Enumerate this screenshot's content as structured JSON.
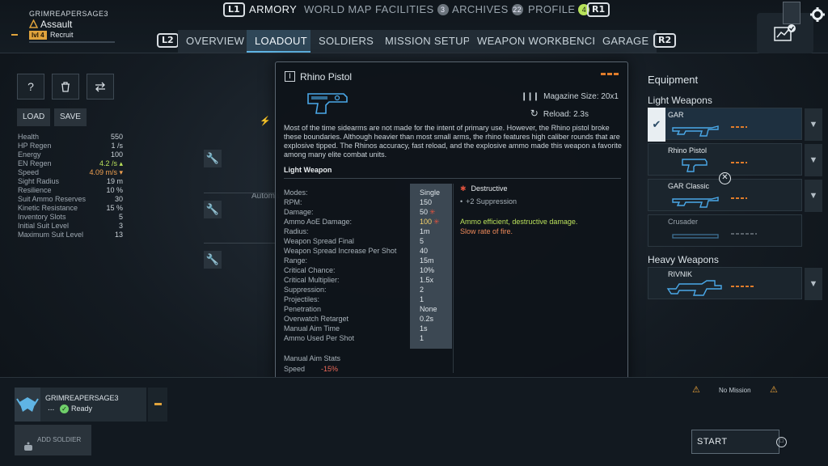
{
  "player": {
    "name": "GRIMREAPERSAGE3",
    "class": "Assault",
    "level": "lvl 4",
    "rank": "Recruit"
  },
  "nav": {
    "left_shoulder": "L1",
    "right_shoulder": "R1",
    "tabs": [
      {
        "label": "ARMORY",
        "badge": ""
      },
      {
        "label": "WORLD MAP",
        "badge": ""
      },
      {
        "label": "FACILITIES",
        "badge": "3"
      },
      {
        "label": "ARCHIVES",
        "badge": "22"
      },
      {
        "label": "PROFILE",
        "badge": "4"
      }
    ],
    "sub_left_shoulder": "L2",
    "sub_right_shoulder": "R2",
    "subtabs": [
      "OVERVIEW",
      "LOADOUT",
      "SOLDIERS",
      "MISSION SETUP",
      "WEAPON WORKBENCH",
      "GARAGE"
    ],
    "active_tab": "ARMORY",
    "active_subtab": "LOADOUT"
  },
  "left_panel": {
    "help_label": "?",
    "load_label": "LOAD",
    "save_label": "SAVE",
    "stats": [
      {
        "label": "Health",
        "value": "550"
      },
      {
        "label": "HP Regen",
        "value": "1 /s"
      },
      {
        "label": "Energy",
        "value": "100"
      },
      {
        "label": "EN Regen",
        "value": "4.2 /s ▴"
      },
      {
        "label": "Speed",
        "value": "4.09 m/s ▾"
      },
      {
        "label": "Sight Radius",
        "value": "19 m"
      },
      {
        "label": "Resilience",
        "value": "10 %"
      },
      {
        "label": "Suit Ammo Reserves",
        "value": "30"
      },
      {
        "label": "Kinetic Resistance",
        "value": "15 %"
      },
      {
        "label": "Inventory Slots",
        "value": "5"
      },
      {
        "label": "Initial Suit Level",
        "value": "3"
      },
      {
        "label": "Maximum Suit Level",
        "value": "13"
      }
    ],
    "background_text": "Automa"
  },
  "tooltip": {
    "title": "Rhino Pistol",
    "magazine": "Magazine Size: 20x1",
    "reload": "Reload: 2.3s",
    "description": "Most of the time sidearms are not made for the intent of primary use. However, the Rhino pistol broke these boundaries. Although heavier than most small arms, the rhino features high caliber rounds that are explosive tipped. The Rhinos accuracy, fast reload, and the explosive ammo made this weapon a favorite among many elite combat units.",
    "category": "Light Weapon",
    "stats": [
      {
        "label": "Modes:",
        "value": "Single"
      },
      {
        "label": "RPM:",
        "value": "150"
      },
      {
        "label": "Damage:",
        "value": "50"
      },
      {
        "label": "Ammo AoE Damage:",
        "value": "100"
      },
      {
        "label": "Radius:",
        "value": "1m"
      },
      {
        "label": "Weapon Spread Final",
        "value": "5"
      },
      {
        "label": "Weapon Spread Increase Per Shot",
        "value": "40"
      },
      {
        "label": "Range:",
        "value": "15m"
      },
      {
        "label": "Critical Chance:",
        "value": "10%"
      },
      {
        "label": "Critical Multiplier:",
        "value": "1.5x"
      },
      {
        "label": "Suppression:",
        "value": "2"
      },
      {
        "label": "Projectiles:",
        "value": "1"
      },
      {
        "label": "Penetration",
        "value": "None"
      },
      {
        "label": "Overwatch Retarget",
        "value": "0.2s"
      },
      {
        "label": "Manual Aim Time",
        "value": "1s"
      },
      {
        "label": "Ammo Used Per Shot",
        "value": "1"
      }
    ],
    "trait_name": "Destructive",
    "trait_bonus": "+2 Suppression",
    "pro": "Ammo efficient, destructive damage.",
    "con": "Slow rate of fire.",
    "manual_aim_header": "Manual Aim Stats",
    "speed_label": "Speed",
    "speed_value": "-15%"
  },
  "equipment": {
    "title": "Equipment",
    "light_header": "Light Weapons",
    "heavy_header": "Heavy Weapons",
    "light": [
      "GAR",
      "Rhino Pistol",
      "GAR Classic",
      "Crusader"
    ],
    "heavy": [
      "RIVNIK"
    ]
  },
  "squad": {
    "soldier_name": "GRIMREAPERSAGE3",
    "dots": "...",
    "status": "Ready",
    "add_soldier": "ADD SOLDIER"
  },
  "mission": {
    "status": "No Mission",
    "start_label": "START"
  },
  "colors": {
    "accent": "#5fb4e4",
    "warning": "#f0a63a",
    "rarity": "#e07c2a",
    "positive": "#b9e05b",
    "negative": "#ef6a5a"
  }
}
